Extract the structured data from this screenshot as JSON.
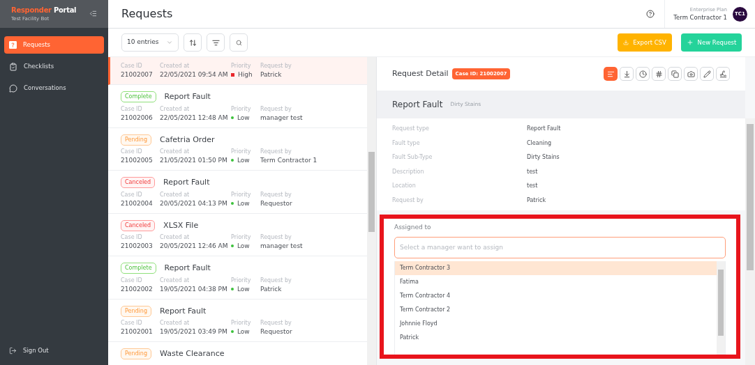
{
  "brand": {
    "name_accent": "Responder",
    "name_rest": "Portal",
    "subtitle": "Test Facility Bot"
  },
  "sidebar": {
    "items": [
      {
        "kind": "requests",
        "label": "Requests",
        "selected": true
      },
      {
        "kind": "checklists",
        "label": "Checklists",
        "selected": false
      },
      {
        "kind": "conversations",
        "label": "Conversations",
        "selected": false
      }
    ],
    "sign_out": "Sign Out"
  },
  "header": {
    "title": "Requests",
    "plan": "Enterprise Plan",
    "user": "Term Contractor 1",
    "avatar": "TC1"
  },
  "toolbar": {
    "entries": "10 entries",
    "export": "Export CSV",
    "new": "New Request"
  },
  "requests": [
    {
      "selected": true,
      "case_label": "Case ID",
      "case_id": "21002007",
      "created_label": "Created at",
      "created": "22/05/2021 09:54 AM",
      "priority_label": "Priority",
      "priority": "High",
      "color": "#e8272c",
      "by_label": "Request by",
      "by": "Patrick"
    },
    {
      "selected": false,
      "status": "Complete",
      "kind": "complete",
      "title": "Report Fault",
      "case_label": "Case ID",
      "case_id": "21002006",
      "created_label": "Created at",
      "created": "22/05/2021 12:48 AM",
      "priority_label": "Priority",
      "priority": "Low",
      "color": "#3cc13b",
      "by_label": "Request by",
      "by": "manager test"
    },
    {
      "selected": false,
      "status": "Pending",
      "kind": "pending",
      "title": "Cafetria Order",
      "case_label": "Case ID",
      "case_id": "21002005",
      "created_label": "Created at",
      "created": "21/05/2021 01:50 PM",
      "priority_label": "Priority",
      "priority": "Low",
      "color": "#3cc13b",
      "by_label": "Request by",
      "by": "Term Contractor 1"
    },
    {
      "selected": false,
      "status": "Canceled",
      "kind": "canceled",
      "title": "Report Fault",
      "case_label": "Case ID",
      "case_id": "21002004",
      "created_label": "Created at",
      "created": "20/05/2021 04:13 PM",
      "priority_label": "Priority",
      "priority": "Low",
      "color": "#3cc13b",
      "by_label": "Request by",
      "by": "Requestor"
    },
    {
      "selected": false,
      "status": "Canceled",
      "kind": "canceled",
      "title": "XLSX File",
      "case_label": "Case ID",
      "case_id": "21002003",
      "created_label": "Created at",
      "created": "20/05/2021 12:46 AM",
      "priority_label": "Priority",
      "priority": "Low",
      "color": "#3cc13b",
      "by_label": "Request by",
      "by": "manager test"
    },
    {
      "selected": false,
      "status": "Complete",
      "kind": "complete",
      "title": "Report Fault",
      "case_label": "Case ID",
      "case_id": "21002002",
      "created_label": "Created at",
      "created": "19/05/2021 04:38 PM",
      "priority_label": "Priority",
      "priority": "Low",
      "color": "#3cc13b",
      "by_label": "Request by",
      "by": "Patrick"
    },
    {
      "selected": false,
      "status": "Pending",
      "kind": "pending",
      "title": "Report Fault",
      "case_label": "Case ID",
      "case_id": "21002001",
      "created_label": "Created at",
      "created": "19/05/2021 03:49 PM",
      "priority_label": "Priority",
      "priority": "Low",
      "color": "#3cc13b",
      "by_label": "Request by",
      "by": "Requestor"
    },
    {
      "selected": false,
      "status": "Pending",
      "kind": "pending",
      "title": "Waste Clearance"
    }
  ],
  "detail": {
    "title": "Request Detail",
    "case_badge": "Case ID: 21002007",
    "actions": [
      {
        "kind": "details",
        "selected": true
      },
      {
        "kind": "download",
        "selected": false
      },
      {
        "kind": "history",
        "selected": false
      },
      {
        "kind": "hash",
        "selected": false
      },
      {
        "kind": "chat",
        "selected": false
      },
      {
        "kind": "photo",
        "selected": false
      },
      {
        "kind": "edit",
        "selected": false
      },
      {
        "kind": "signature",
        "selected": false
      }
    ],
    "heading": "Report Fault",
    "subheading": "Dirty Stains",
    "fields": [
      {
        "label": "Request type",
        "value": "Report Fault"
      },
      {
        "label": "Fault type",
        "value": "Cleaning"
      },
      {
        "label": "Fault Sub-Type",
        "value": "Dirty Stains"
      },
      {
        "label": "Description",
        "value": "test"
      },
      {
        "label": "Location",
        "value": "test"
      },
      {
        "label": "Request by",
        "value": "Patrick"
      }
    ],
    "assign": {
      "label": "Assigned to",
      "placeholder": "Select a manager want to assign",
      "options": [
        {
          "label": "Term Contractor 3",
          "selected": true
        },
        {
          "label": "Fatima",
          "selected": false
        },
        {
          "label": "Term Contractor 4",
          "selected": false
        },
        {
          "label": "Term Contractor 2",
          "selected": false
        },
        {
          "label": "Johnnie Floyd",
          "selected": false
        },
        {
          "label": "Patrick",
          "selected": false
        }
      ]
    }
  }
}
